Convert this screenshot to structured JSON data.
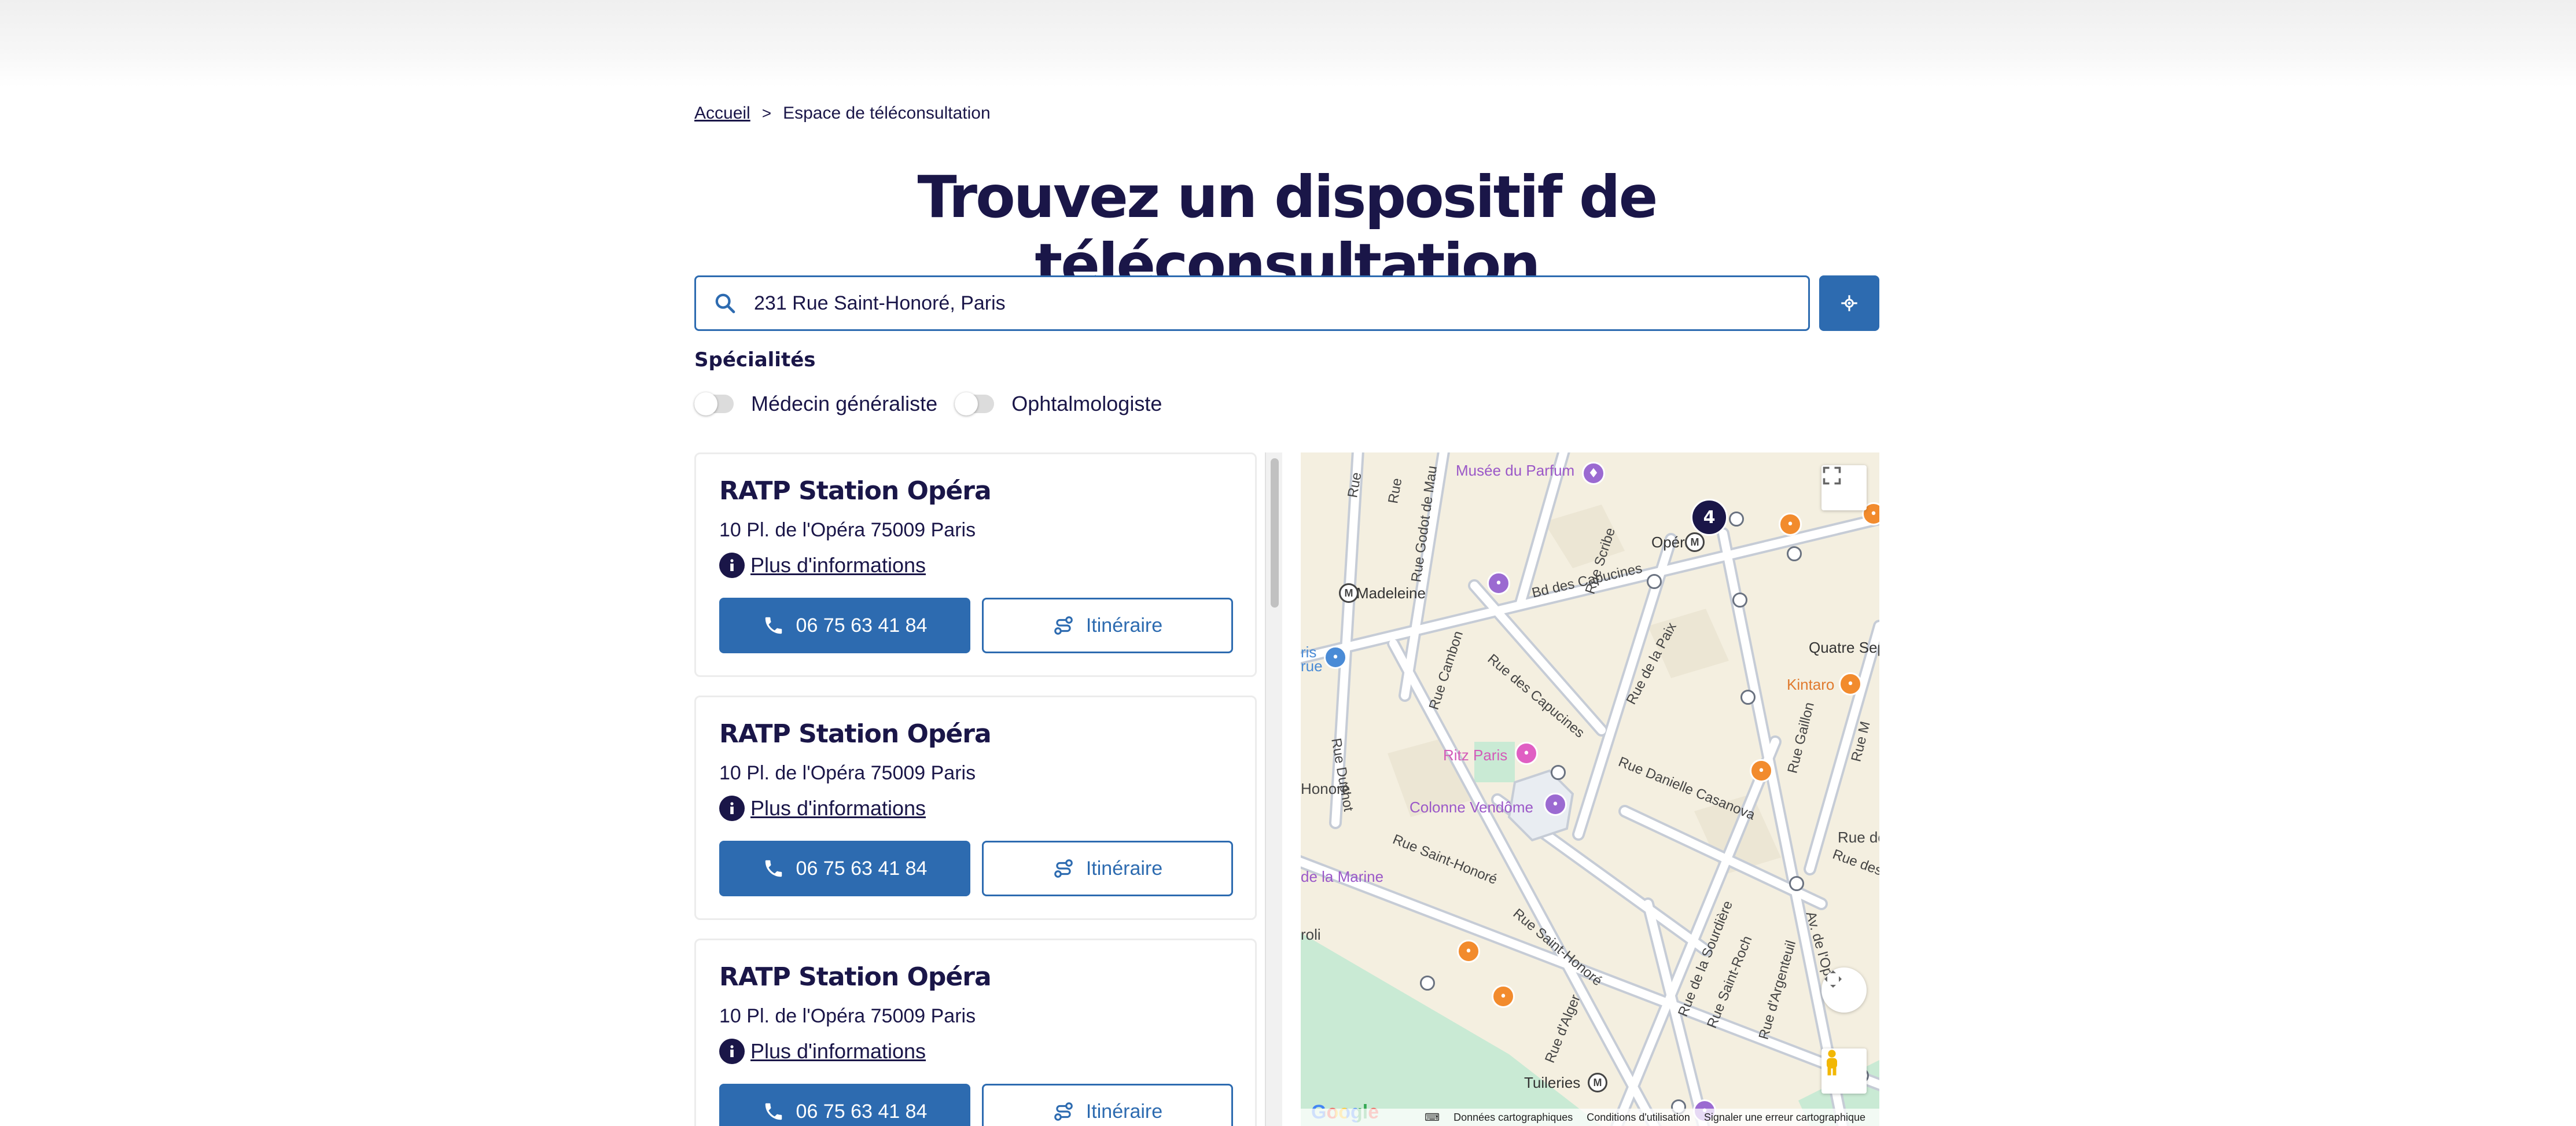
{
  "breadcrumb": {
    "home": "Accueil",
    "separator": ">",
    "current": "Espace de téléconsultation"
  },
  "page_title": "Trouvez un dispositif de téléconsultation",
  "search": {
    "value": "231 Rue Saint-Honoré, Paris",
    "icon": "search-icon"
  },
  "locate_button": {
    "icon": "locate-crosshair-icon"
  },
  "specialties": {
    "label": "Spécialités",
    "toggles": [
      {
        "label": "Médecin généraliste",
        "checked": false
      },
      {
        "label": "Ophtalmologiste",
        "checked": false
      }
    ]
  },
  "results": [
    {
      "name": "RATP Station Opéra",
      "address": "10 Pl. de l'Opéra 75009 Paris",
      "info_link": "Plus d'informations",
      "phone": "06 75 63 41 84",
      "route_label": "Itinéraire"
    },
    {
      "name": "RATP Station Opéra",
      "address": "10 Pl. de l'Opéra 75009 Paris",
      "info_link": "Plus d'informations",
      "phone": "06 75 63 41 84",
      "route_label": "Itinéraire"
    },
    {
      "name": "RATP Station Opéra",
      "address": "10 Pl. de l'Opéra 75009 Paris",
      "info_link": "Plus d'informations",
      "phone": "06 75 63 41 84",
      "route_label": "Itinéraire"
    }
  ],
  "map": {
    "cluster_count": "4",
    "labels": {
      "musee": "Musée du Parfum",
      "opera": "Opéra",
      "madeleine": "Madeleine",
      "quatre": "Quatre Septemb",
      "kintaro": "Kintaro",
      "ritz": "Ritz Paris",
      "vendome": "Colonne Vendôme",
      "marine": "de la Marine",
      "tuileries": "Tuileries",
      "ris": "ris",
      "rue_s": "rue",
      "honore_left": "Honoré",
      "roli": "roli",
      "rue_des_left": "Rue des"
    },
    "streets": {
      "capucines_bd": "Bd des Capucines",
      "cambon": "Rue Cambon",
      "capucines": "Rue des Capucines",
      "paix": "Rue de la Paix",
      "duphot": "Rue Duphot",
      "danielle": "Rue Danielle Casanova",
      "gaillon": "Rue Gaillon",
      "st_honore_1": "Rue Saint-Honoré",
      "st_honore_2": "Rue Saint-Honoré",
      "alger": "Rue d'Alger",
      "sourdiere": "Rue de la Sourdière",
      "st_roch": "Rue Saint-Roch",
      "argenteuil": "Rue d'Argenteuil",
      "av_opera": "Av. de l'Opé",
      "scribe": "Rue Scribe",
      "godot": "Rue Godot de Mau",
      "rue_top": "Rue",
      "rue_top2": "Rue",
      "rue_des_right": "Rue des",
      "rue_m": "Rue M"
    },
    "footer": {
      "keyboard": "⌨",
      "data": "Données cartographiques",
      "terms": "Conditions d'utilisation",
      "report": "Signaler une erreur cartographique"
    },
    "google_logo": "Google",
    "colors": {
      "park": "#c9ead4",
      "road": "#ffffff",
      "road_border": "#c6ccd6",
      "poi_orange": "#f28b2d",
      "poi_purple": "#9b6ad1",
      "poi_pink": "#e05fc3",
      "poi_blue": "#4a8bd6"
    }
  },
  "colors": {
    "primary": "#2d6bb0",
    "navy": "#1a1648",
    "card_border": "#ececec"
  }
}
